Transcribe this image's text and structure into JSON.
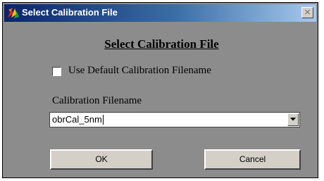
{
  "window": {
    "title": "Select Calibration File",
    "close_glyph": "×",
    "app_icon": "multicolor-app-icon"
  },
  "dialog": {
    "heading": "Select Calibration File",
    "use_default": {
      "label": "Use Default Calibration Filename",
      "checked": false
    },
    "filename_label": "Calibration Filename",
    "filename_value": "obrCal_5nm",
    "dropdown_icon": "chevron-down-icon",
    "ok_label": "OK",
    "cancel_label": "Cancel"
  },
  "colors": {
    "dialog_bg": "#8c8c8c",
    "titlebar_start": "#0a246a",
    "titlebar_end": "#a6caf0",
    "button_face": "#d4d0c8"
  }
}
